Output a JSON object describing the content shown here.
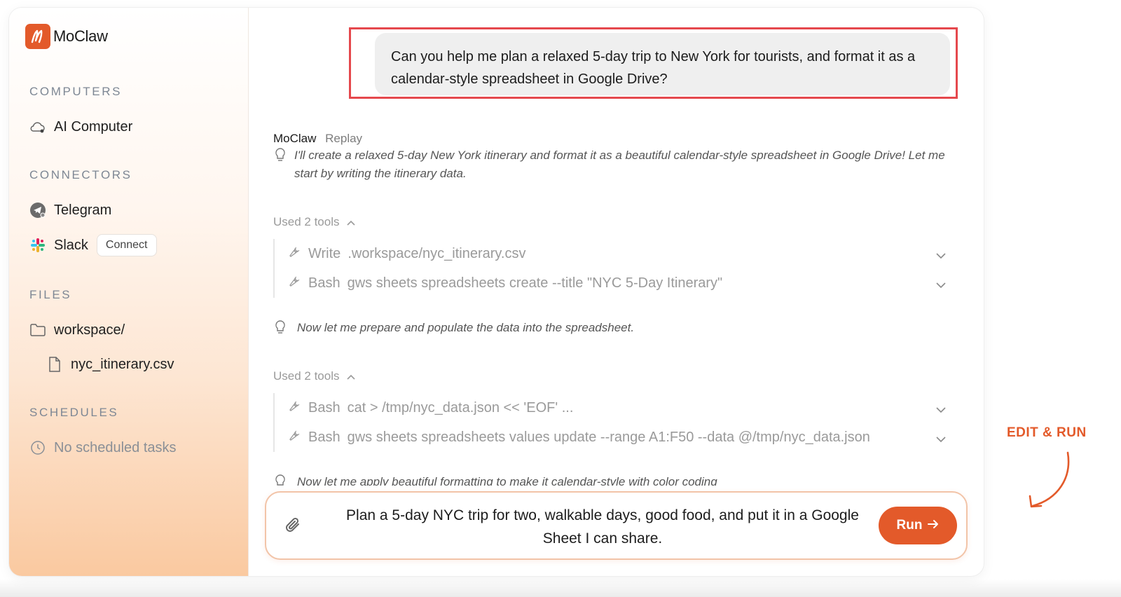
{
  "app": {
    "name": "MoClaw",
    "brand_color": "#e35a2a"
  },
  "sidebar": {
    "computers_title": "COMPUTERS",
    "computer_item": {
      "label": "AI Computer",
      "icon": "cloud-icon"
    },
    "connectors_title": "CONNECTORS",
    "connectors": [
      {
        "label": "Telegram",
        "icon": "telegram-icon"
      },
      {
        "label": "Slack",
        "icon": "slack-icon",
        "action": "Connect"
      }
    ],
    "files_title": "FILES",
    "files": [
      {
        "label": "workspace/",
        "icon": "folder-icon"
      },
      {
        "label": "nyc_itinerary.csv",
        "icon": "file-icon"
      }
    ],
    "schedules_title": "SCHEDULES",
    "schedules_empty": "No scheduled tasks"
  },
  "chat": {
    "user_message": "Can you help me plan a relaxed 5-day trip to New York for tourists, and format it as a calendar-style spreadsheet in Google Drive?",
    "assistant_name": "MoClaw",
    "replay_label": "Replay",
    "thought_1": "I'll create a relaxed 5-day New York itinerary and format it as a beautiful calendar-style spreadsheet in Google Drive! Let me start by writing the itinerary data.",
    "tools_group_1_label": "Used 2 tools",
    "tools_group_1": [
      {
        "tool": "Write",
        "detail": ".workspace/nyc_itinerary.csv"
      },
      {
        "tool": "Bash",
        "detail": "gws sheets spreadsheets create --title \"NYC 5-Day Itinerary\""
      }
    ],
    "thought_2": "Now let me prepare and populate the data into the spreadsheet.",
    "tools_group_2_label": "Used 2 tools",
    "tools_group_2": [
      {
        "tool": "Bash",
        "detail": "cat > /tmp/nyc_data.json << 'EOF' ..."
      },
      {
        "tool": "Bash",
        "detail": "gws sheets spreadsheets values update --range A1:F50 --data @/tmp/nyc_data.json"
      }
    ],
    "thought_3": "Now let me apply beautiful formatting to make it calendar-style with color coding"
  },
  "composer": {
    "text": "Plan a 5-day NYC trip for two, walkable days, good food, and put it in a Google Sheet I can share.",
    "run_label": "Run"
  },
  "annotation": "EDIT & RUN"
}
